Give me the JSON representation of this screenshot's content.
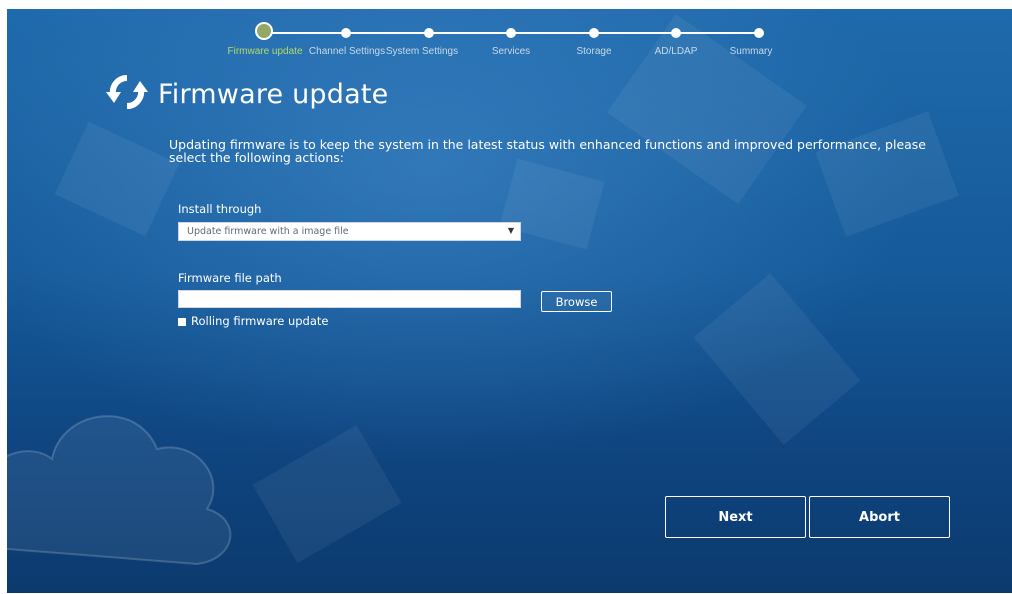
{
  "wizard": {
    "steps": [
      {
        "label": "Firmware update",
        "current": true
      },
      {
        "label": "Channel Settings",
        "current": false
      },
      {
        "label": "System Settings",
        "current": false
      },
      {
        "label": "Services",
        "current": false
      },
      {
        "label": "Storage",
        "current": false
      },
      {
        "label": "AD/LDAP",
        "current": false
      },
      {
        "label": "Summary",
        "current": false
      }
    ]
  },
  "header": {
    "icon": "refresh-icon",
    "title": "Firmware update"
  },
  "description": "Updating firmware is to keep the system in the latest status with enhanced functions and improved performance, please select the following actions:",
  "install": {
    "label": "Install through",
    "selected": "Update firmware with a image file"
  },
  "file": {
    "label": "Firmware file path",
    "value": "",
    "browse_label": "Browse"
  },
  "rolling": {
    "label": "Rolling firmware update",
    "checked": true
  },
  "footer": {
    "next_label": "Next",
    "abort_label": "Abort"
  },
  "colors": {
    "background": "#155a9a",
    "current_step": "#93a867",
    "current_step_label": "#b6d96b",
    "text": "#ffffff"
  }
}
